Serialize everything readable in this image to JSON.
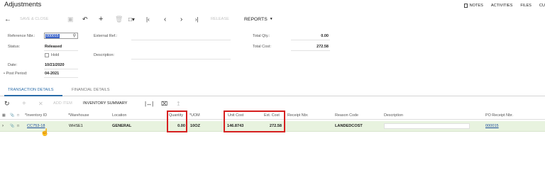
{
  "page": {
    "title": "Adjustments"
  },
  "top_links": [
    "NOTES",
    "ACTIVITIES",
    "FILES",
    "CU"
  ],
  "toolbar": {
    "back_icon": "arrow-left",
    "save_close": "SAVE & CLOSE",
    "save_icon": "floppy-disk",
    "undo_icon": "undo-arrow",
    "add_icon": "plus",
    "delete_icon": "trash",
    "copy_icon": "copy",
    "first_icon": "first-page",
    "prev_icon": "chevron-left",
    "next_icon": "chevron-right",
    "last_icon": "last-page",
    "release": "RELEASE",
    "reports": "REPORTS"
  },
  "header": {
    "reference_nbr": {
      "label": "Reference Nbr.:",
      "value": "000015"
    },
    "status": {
      "label": "Status:",
      "value": "Released"
    },
    "hold": {
      "label": "Hold"
    },
    "date": {
      "label": "Date:",
      "value": "10/21/2020"
    },
    "post_period": {
      "label": "• Post Period:",
      "value": "04-2021"
    },
    "external_ref": {
      "label": "External Ref.:"
    },
    "description": {
      "label": "Description:"
    },
    "total_qty": {
      "label": "Total Qty.:",
      "value": "0.00"
    },
    "total_cost": {
      "label": "Total Cost:",
      "value": "272.58"
    }
  },
  "tabs": [
    {
      "label": "TRANSACTION DETAILS",
      "active": true
    },
    {
      "label": "FINANCIAL DETAILS",
      "active": false
    }
  ],
  "grid_toolbar": {
    "refresh_icon": "refresh",
    "add_icon": "plus",
    "delete_icon": "x",
    "add_item": "ADD ITEM",
    "inventory_summary": "INVENTORY SUMMARY",
    "fit_icon": "fit-columns",
    "excel_icon": "excel-export",
    "upload_icon": "upload"
  },
  "grid": {
    "columns": [
      "*Inventory ID",
      "*Warehouse",
      "Location",
      "Quantity",
      "*UOM",
      "Unit Cost",
      "Ext. Cost",
      "Receipt Nbr.",
      "Reason Code",
      "Description",
      "PO Receipt Nbr."
    ],
    "rows": [
      {
        "inventory_id": "CC753-18",
        "warehouse": "WHSE1",
        "location": "GENERAL",
        "quantity": "0.00",
        "uom": "10OZ",
        "unit_cost": "146.8743",
        "ext_cost": "272.58",
        "receipt_nbr": "",
        "reason_code": "LANDEDCOST",
        "description": "",
        "po_receipt_nbr": "000015"
      }
    ]
  },
  "colors": {
    "accent": "#2a6ca8",
    "row_highlight": "#e8f3df",
    "annotation": "#d61f1f",
    "selection": "#3a63c8"
  }
}
